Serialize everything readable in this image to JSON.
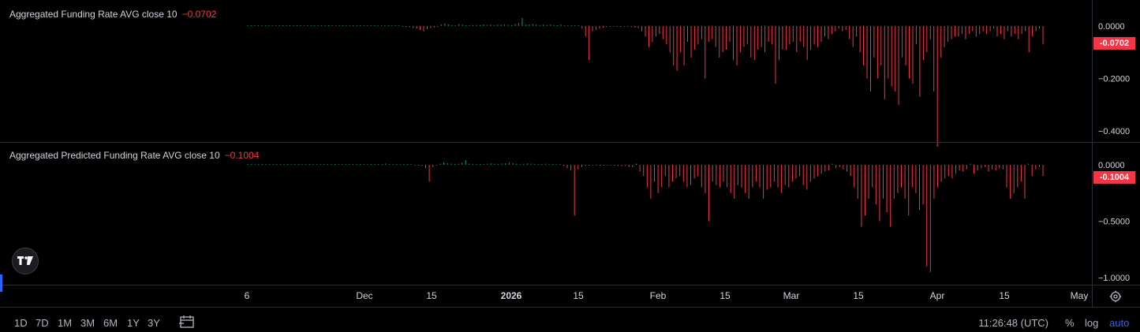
{
  "colors": {
    "background": "#000000",
    "positive": "#089981",
    "negative": "#f23645",
    "text": "#d1d4dc",
    "grid": "#2a2e39",
    "accent": "#2962ff"
  },
  "chart_data": [
    {
      "type": "bar",
      "title": "Aggregated Funding Rate AVG close 10",
      "last_value": "−0.0702",
      "last_value_tag": "-0.0702",
      "y_ticks": [
        "0.0000",
        "−0.2000",
        "−0.4000"
      ],
      "y_tick_values": [
        0,
        -0.2,
        -0.4
      ],
      "ylim": [
        -0.5,
        0.05
      ],
      "values": [
        0.002,
        0.002,
        0.002,
        0.002,
        0.002,
        0.002,
        0.002,
        0.002,
        0.002,
        0.002,
        0.002,
        0.002,
        0.002,
        0.002,
        0.002,
        0.002,
        0.002,
        0.002,
        0.002,
        0.002,
        0.002,
        0.002,
        0.002,
        0.002,
        0.002,
        0.002,
        0.002,
        0.002,
        0.002,
        0.002,
        0.002,
        0.002,
        0.002,
        0.002,
        0.002,
        0.002,
        0.002,
        0.002,
        0.002,
        0.002,
        0.002,
        0.002,
        0.002,
        0.002,
        -0.003,
        -0.004,
        -0.005,
        -0.008,
        -0.01,
        -0.015,
        -0.02,
        -0.012,
        -0.008,
        -0.005,
        -0.003,
        0.006,
        0.01,
        0.006,
        0.004,
        0.003,
        0.007,
        0.005,
        0.003,
        0.003,
        0.004,
        0.004,
        0.004,
        0.006,
        0.005,
        0.005,
        0.004,
        0.005,
        0.005,
        0.006,
        0.005,
        0.004,
        0.008,
        0.012,
        0.03,
        0.005,
        0.006,
        0.008,
        0.006,
        0.004,
        0.005,
        0.004,
        0.006,
        0.004,
        0.003,
        0.006,
        0.003,
        0.002,
        0.003,
        0.002,
        0.002,
        -0.01,
        -0.04,
        -0.13,
        -0.02,
        -0.015,
        -0.01,
        -0.006,
        -0.004,
        -0.003,
        -0.002,
        -0.002,
        -0.001,
        -0.002,
        -0.002,
        -0.004,
        -0.005,
        -0.008,
        -0.02,
        -0.04,
        -0.08,
        -0.06,
        -0.04,
        -0.03,
        -0.05,
        -0.07,
        -0.1,
        -0.15,
        -0.17,
        -0.1,
        -0.15,
        -0.06,
        -0.12,
        -0.09,
        -0.07,
        -0.05,
        -0.2,
        -0.06,
        -0.05,
        -0.08,
        -0.12,
        -0.1,
        -0.09,
        -0.06,
        -0.13,
        -0.15,
        -0.1,
        -0.08,
        -0.07,
        -0.12,
        -0.13,
        -0.09,
        -0.08,
        -0.1,
        -0.06,
        -0.07,
        -0.22,
        -0.13,
        -0.09,
        -0.09,
        -0.07,
        -0.06,
        -0.1,
        -0.06,
        -0.08,
        -0.13,
        -0.09,
        -0.07,
        -0.08,
        -0.06,
        -0.04,
        -0.05,
        -0.03,
        -0.02,
        -0.01,
        -0.02,
        -0.015,
        -0.05,
        -0.08,
        -0.04,
        -0.1,
        -0.15,
        -0.2,
        -0.25,
        -0.12,
        -0.2,
        -0.15,
        -0.28,
        -0.2,
        -0.23,
        -0.25,
        -0.3,
        -0.12,
        -0.15,
        -0.2,
        -0.22,
        -0.07,
        -0.27,
        -0.13,
        -0.1,
        -0.05,
        -0.25,
        -0.46,
        -0.12,
        -0.08,
        -0.06,
        -0.05,
        -0.04,
        -0.04,
        -0.03,
        -0.05,
        -0.03,
        -0.02,
        -0.04,
        -0.03,
        -0.02,
        -0.03,
        -0.02,
        -0.01,
        -0.04,
        -0.03,
        -0.05,
        -0.02,
        -0.04,
        -0.03,
        -0.05,
        -0.03,
        -0.02,
        -0.1,
        -0.04,
        -0.02,
        -0.01,
        -0.07
      ]
    },
    {
      "type": "bar",
      "title": "Aggregated Predicted Funding Rate AVG close 10",
      "last_value": "−0.1004",
      "last_value_tag": "-0.1004",
      "y_ticks": [
        "0.0000",
        "−0.5000",
        "−1.0000"
      ],
      "y_tick_values": [
        0,
        -0.5,
        -1.0
      ],
      "ylim": [
        -1.03,
        0.08
      ],
      "values": [
        0.004,
        0.004,
        0.004,
        0.004,
        0.004,
        0.004,
        0.004,
        0.004,
        0.004,
        0.004,
        0.004,
        0.004,
        0.004,
        0.004,
        0.004,
        0.004,
        0.004,
        0.004,
        0.004,
        0.004,
        0.004,
        0.004,
        0.004,
        0.004,
        0.004,
        0.004,
        0.004,
        0.004,
        0.004,
        0.004,
        0.004,
        0.004,
        0.004,
        0.004,
        0.004,
        0.004,
        0.006,
        0.008,
        0.012,
        0.008,
        0.006,
        0.004,
        0.004,
        0.004,
        0.004,
        0.004,
        -0.003,
        -0.006,
        -0.01,
        -0.03,
        -0.15,
        -0.02,
        -0.008,
        0.01,
        0.02,
        0.015,
        0.01,
        0.008,
        0.01,
        0.02,
        0.04,
        0.01,
        0.008,
        0.006,
        0.006,
        0.008,
        0.01,
        0.012,
        0.01,
        0.008,
        0.012,
        0.015,
        0.02,
        0.015,
        0.01,
        0.008,
        0.01,
        0.012,
        0.01,
        0.008,
        0.006,
        0.008,
        0.01,
        0.008,
        0.006,
        0.004,
        0.004,
        -0.01,
        -0.03,
        -0.05,
        -0.45,
        -0.04,
        -0.02,
        -0.01,
        -0.006,
        -0.006,
        -0.006,
        -0.006,
        -0.006,
        -0.006,
        -0.006,
        -0.006,
        -0.01,
        -0.01,
        -0.01,
        -0.02,
        -0.02,
        0.01,
        -0.06,
        -0.1,
        -0.2,
        -0.3,
        -0.15,
        -0.25,
        -0.2,
        -0.1,
        -0.2,
        -0.15,
        -0.12,
        -0.1,
        -0.15,
        -0.2,
        -0.18,
        -0.12,
        -0.1,
        -0.2,
        -0.25,
        -0.5,
        -0.15,
        -0.18,
        -0.2,
        -0.15,
        -0.2,
        -0.25,
        -0.3,
        -0.18,
        -0.2,
        -0.25,
        -0.3,
        -0.2,
        -0.15,
        -0.2,
        -0.3,
        -0.22,
        -0.2,
        -0.15,
        -0.2,
        -0.25,
        -0.18,
        -0.2,
        -0.15,
        -0.12,
        -0.1,
        -0.18,
        -0.22,
        -0.15,
        -0.12,
        -0.1,
        -0.08,
        -0.06,
        -0.05,
        0.01,
        -0.03,
        -0.02,
        -0.04,
        -0.06,
        -0.1,
        -0.2,
        -0.3,
        -0.55,
        -0.45,
        -0.3,
        -0.2,
        -0.35,
        -0.5,
        -0.3,
        -0.42,
        -0.55,
        -0.3,
        -0.25,
        -0.2,
        -0.3,
        -0.45,
        -0.2,
        -0.25,
        -0.4,
        -0.35,
        -0.9,
        -0.95,
        -0.3,
        -0.2,
        -0.15,
        -0.12,
        -0.1,
        -0.12,
        -0.08,
        -0.05,
        -0.06,
        -0.04,
        0.01,
        -0.08,
        -0.05,
        -0.03,
        -0.02,
        -0.06,
        -0.04,
        -0.05,
        -0.03,
        -0.04,
        -0.2,
        -0.3,
        -0.25,
        -0.2,
        -0.15,
        -0.3,
        0.01,
        -0.1,
        -0.04,
        -0.02,
        -0.1
      ]
    }
  ],
  "x_axis": {
    "ticks": [
      {
        "label": "6",
        "bold": false
      },
      {
        "label": "Dec",
        "bold": false
      },
      {
        "label": "15",
        "bold": false
      },
      {
        "label": "2026",
        "bold": true
      },
      {
        "label": "15",
        "bold": false
      },
      {
        "label": "Feb",
        "bold": false
      },
      {
        "label": "15",
        "bold": false
      },
      {
        "label": "Mar",
        "bold": false
      },
      {
        "label": "15",
        "bold": false
      },
      {
        "label": "Apr",
        "bold": false
      },
      {
        "label": "15",
        "bold": false
      },
      {
        "label": "May",
        "bold": false
      }
    ]
  },
  "bottom_bar": {
    "ranges": [
      "1D",
      "7D",
      "1M",
      "3M",
      "6M",
      "1Y",
      "3Y"
    ],
    "clock": "11:26:48 (UTC)",
    "percent_label": "%",
    "log_label": "log",
    "auto_label": "auto"
  },
  "icons": {
    "logo": "tradingview-logo-icon",
    "calendar": "calendar-icon",
    "settings": "gear-icon"
  }
}
